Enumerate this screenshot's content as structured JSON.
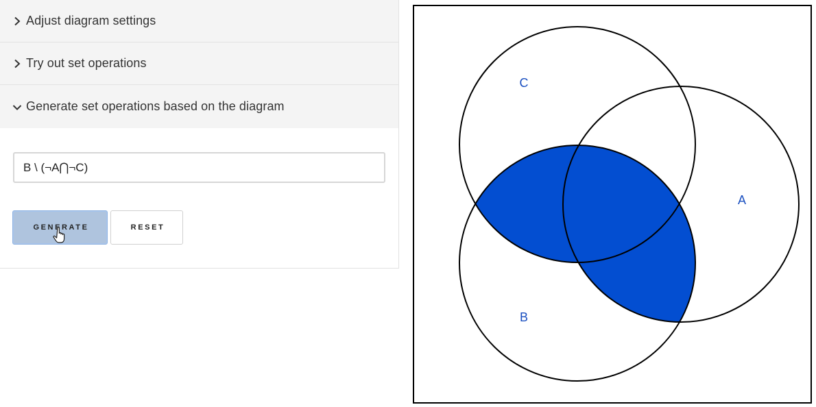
{
  "accordion": {
    "sections": [
      {
        "label": "Adjust diagram settings",
        "expanded": false
      },
      {
        "label": "Try out set operations",
        "expanded": false
      },
      {
        "label": "Generate set operations based on the diagram",
        "expanded": true
      }
    ]
  },
  "generator": {
    "expression_value": "B \\ (¬A⋂¬C)",
    "generate_label": "GENERATE",
    "reset_label": "RESET"
  },
  "diagram": {
    "sets": [
      {
        "label": "C"
      },
      {
        "label": "A"
      },
      {
        "label": "B"
      }
    ],
    "fill_color": "#034ed1",
    "stroke_color": "#000000",
    "frame_color": "#000000"
  }
}
